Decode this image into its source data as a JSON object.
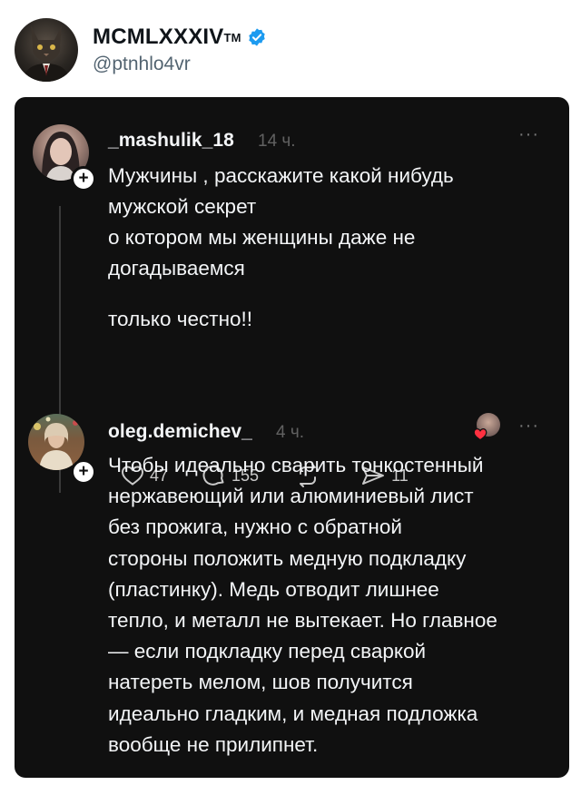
{
  "tweet": {
    "author_name": "MCMLXXXIV",
    "author_tm": "TM",
    "author_handle": "@ptnhlo4vr"
  },
  "screenshot": {
    "post1": {
      "username": "_mashulik_18",
      "time": "14 ч.",
      "text": "Мужчины , расскажите какой нибудь\nмужской секрет\nо котором мы женщины  даже не\nдогадываемся",
      "text2": "только честно!!",
      "likes": "47",
      "comments": "155",
      "shares": "11"
    },
    "post2": {
      "username": "oleg.demichev_",
      "time": "4 ч.",
      "text": "Чтобы идеально сварить тонкостенный\nнержавеющий или алюминиевый лист\nбез прожига, нужно с обратной\nстороны положить медную подкладку\n(пластинку). Медь отводит лишнее\nтепло, и металл не вытекает. Но главное\n— если подкладку перед сваркой\nнатереть мелом, шов получится\nидеально гладким, и медная подложка\nвообще не прилипнет."
    },
    "more_label": "···",
    "plus_label": "+"
  },
  "icons": {
    "verified": "verified-badge-icon",
    "like": "heart-icon",
    "comment": "comment-icon",
    "repost": "repost-icon",
    "share": "share-icon"
  },
  "colors": {
    "verified_blue": "#1d9bf0",
    "card_bg": "#101010",
    "like_red": "#ff3040"
  }
}
